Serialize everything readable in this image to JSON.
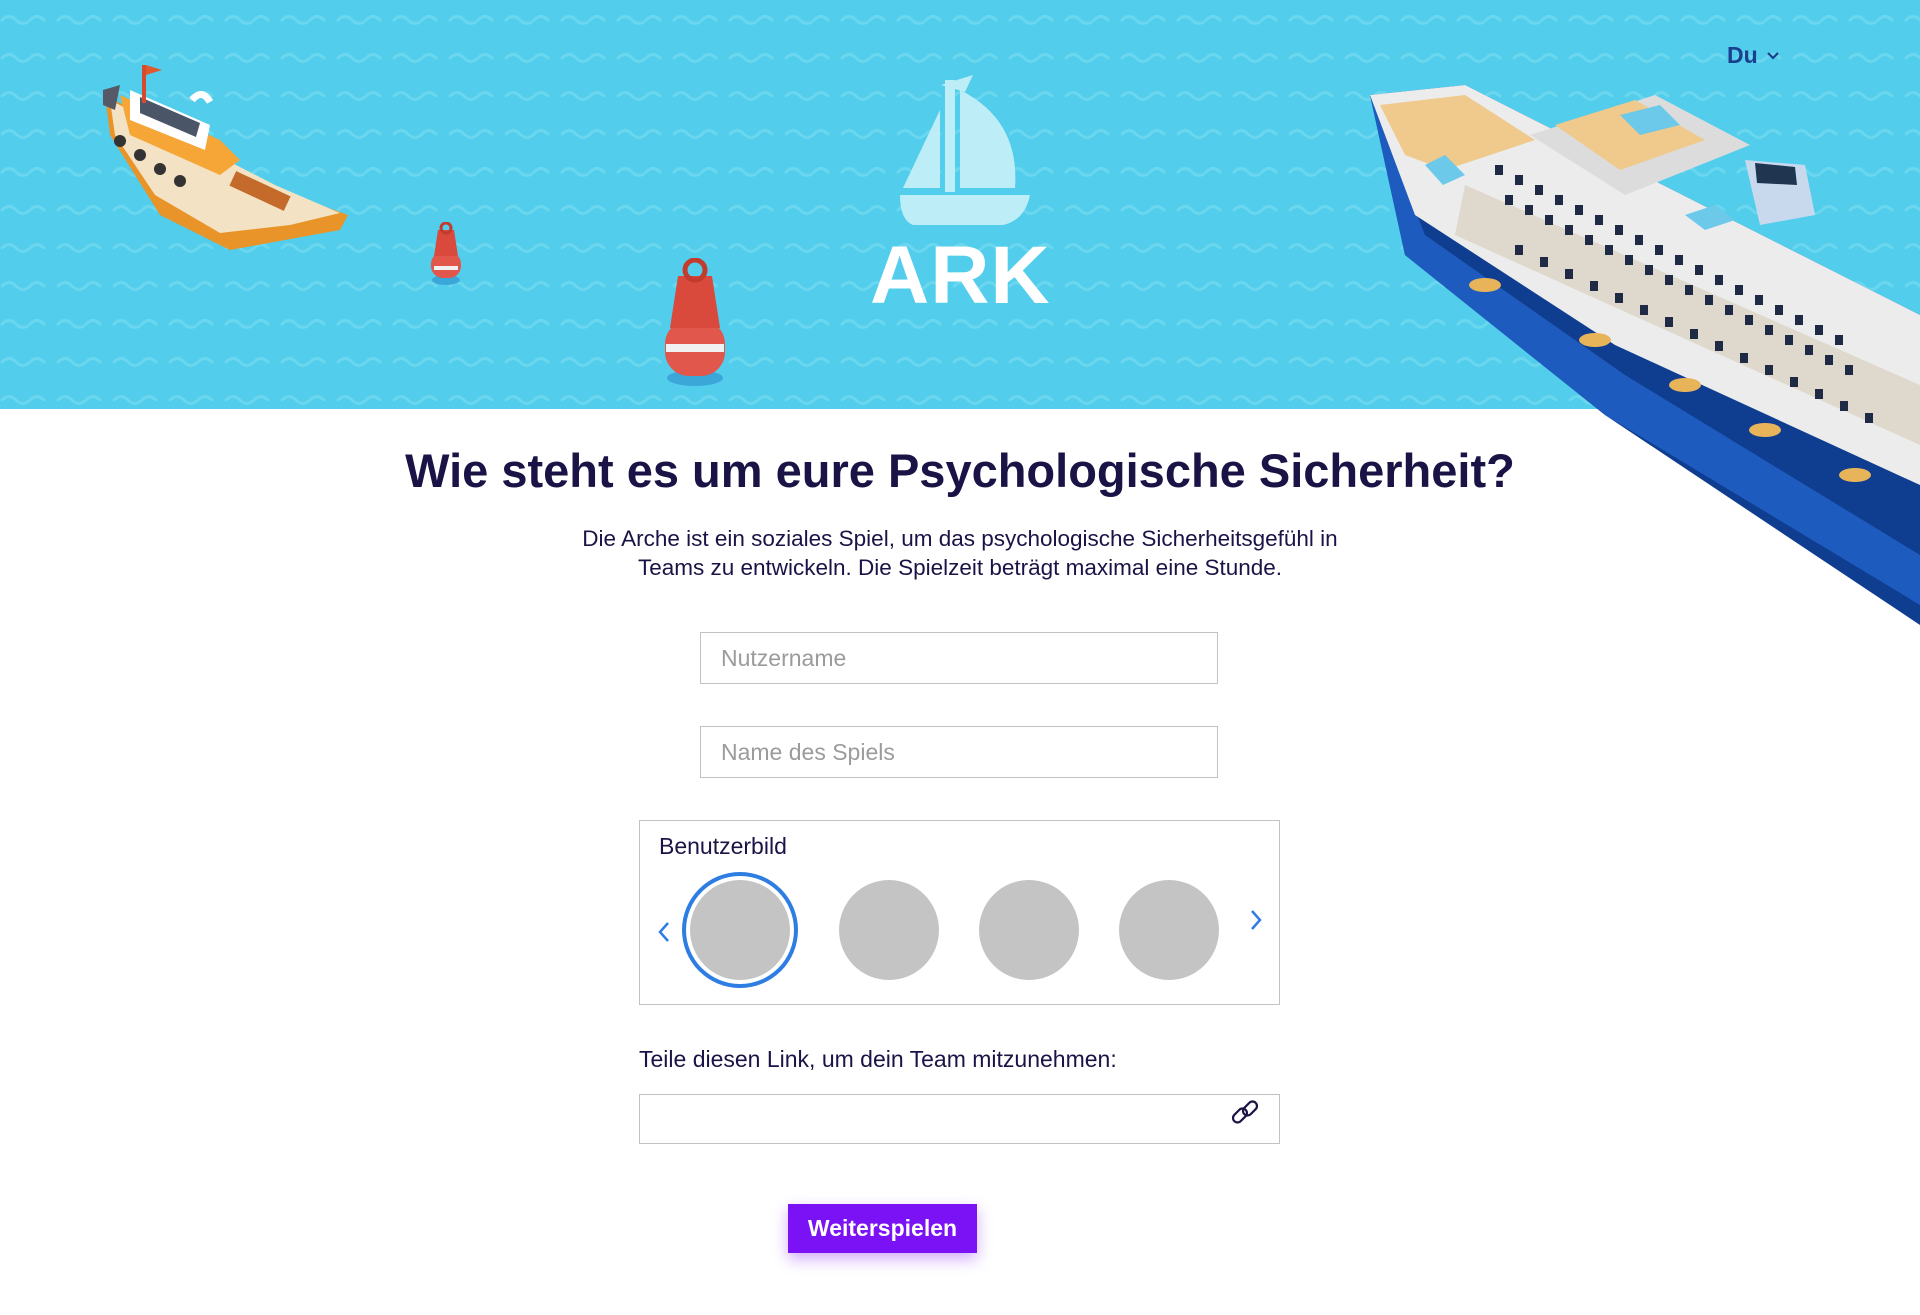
{
  "header": {
    "language_label": "Du",
    "logo_text": "ARK"
  },
  "main": {
    "title": "Wie steht es um eure Psychologische Sicherheit?",
    "intro_line1": "Die Arche ist ein soziales Spiel, um das psychologische Sicherheitsgefühl in",
    "intro_line2": "Teams zu entwickeln. Die Spielzeit beträgt maximal eine Stunde."
  },
  "form": {
    "username_placeholder": "Nutzername",
    "username_value": "",
    "gamename_placeholder": "Name des Spiels",
    "gamename_value": "",
    "avatar_label": "Benutzerbild",
    "avatar_count_visible": 4,
    "avatar_selected_index": 0,
    "share_label": "Teile diesen Link, um dein Team mitzunehmen:",
    "share_value": "",
    "continue_label": "Weiterspielen"
  },
  "icons": {
    "language_chevron": "chevron-down-icon",
    "logo": "sailboat-icon",
    "avatar_prev": "chevron-left-icon",
    "avatar_next": "chevron-right-icon",
    "copy_link": "link-icon"
  },
  "colors": {
    "sky": "#52cdec",
    "text_dark": "#1a1446",
    "accent_blue": "#2d7de2",
    "button_purple": "#7a12f5",
    "avatar_gray": "#c4c4c4"
  }
}
